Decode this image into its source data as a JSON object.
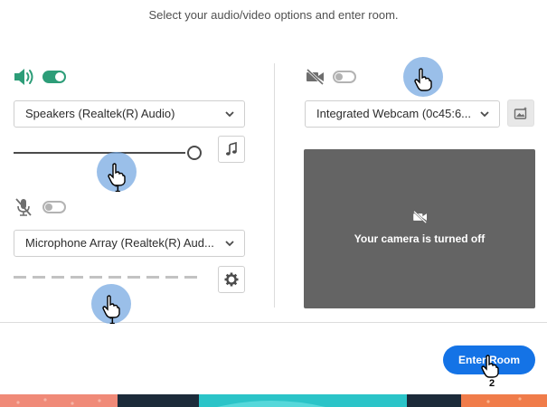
{
  "header": {
    "title": "Select your audio/video options and enter room."
  },
  "audio": {
    "speaker_toggle_on": true,
    "speaker_select": "Speakers (Realtek(R) Audio)",
    "speaker_volume": 0.95,
    "mic_toggle_on": false,
    "mic_select": "Microphone Array (Realtek(R) Aud...",
    "mic_level": 0
  },
  "video": {
    "camera_toggle_on": false,
    "camera_select": "Integrated Webcam (0c45:6...",
    "preview_message": "Your camera is turned off"
  },
  "footer": {
    "enter_label": "Enter Room"
  },
  "annotations": [
    {
      "step": "1",
      "target": "speaker-volume-slider"
    },
    {
      "step": "1",
      "target": "mic-level-meter"
    },
    {
      "step": "",
      "target": "camera-toggle"
    },
    {
      "step": "2",
      "target": "enter-room-button"
    }
  ],
  "colors": {
    "toggle_on": "#2d9d78",
    "accent": "#1473e6",
    "preview_bg": "#646464"
  },
  "icons": {
    "speaker": "speaker-volume-icon",
    "mic": "mic-muted-icon",
    "camera": "camera-off-icon",
    "music": "music-note-icon",
    "settings": "gear-icon",
    "background": "image-effects-icon"
  }
}
